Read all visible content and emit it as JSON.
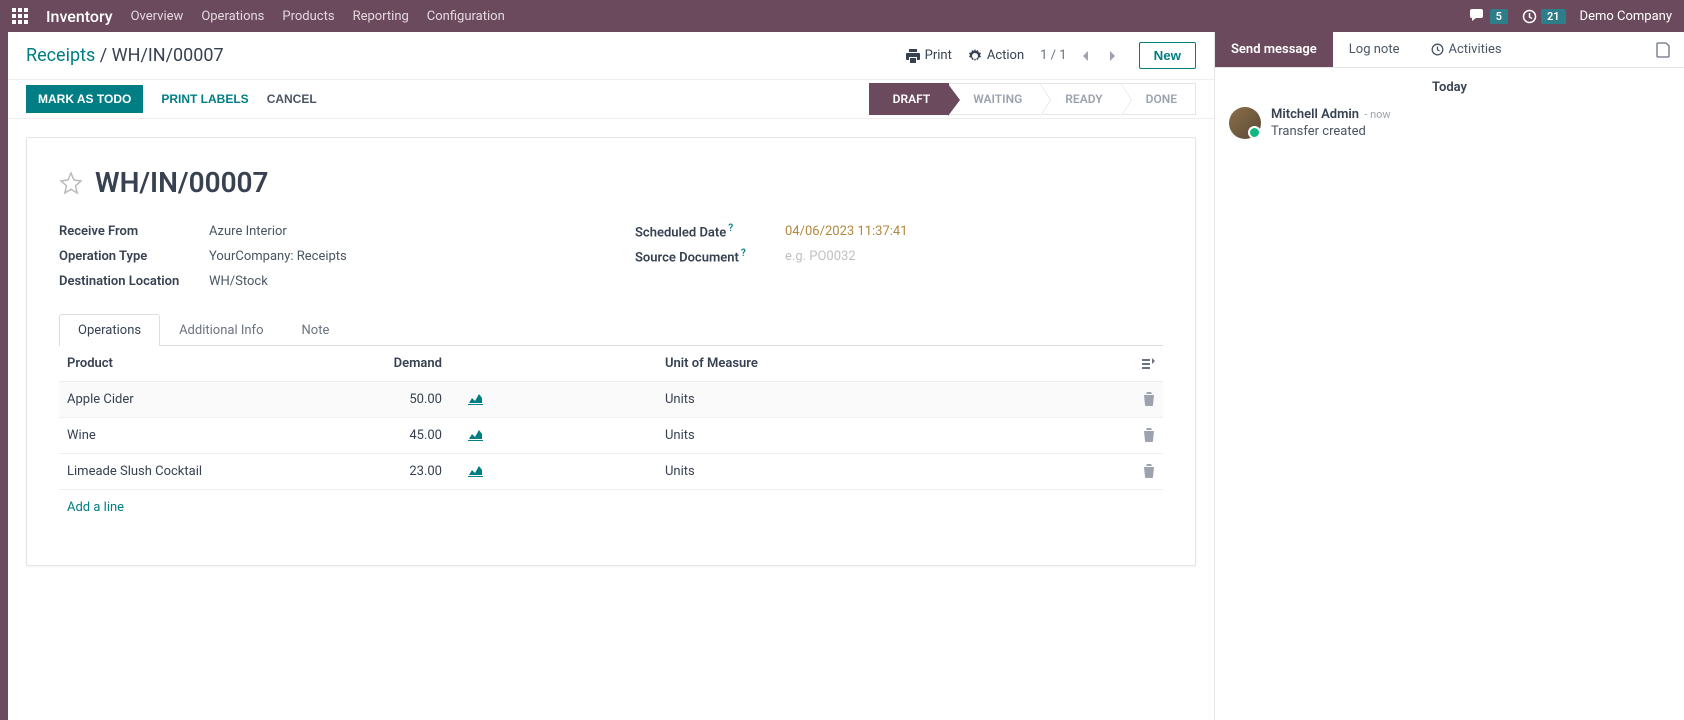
{
  "nav": {
    "app": "Inventory",
    "items": [
      "Overview",
      "Operations",
      "Products",
      "Reporting",
      "Configuration"
    ],
    "chat_badge": "5",
    "clock_badge": "21",
    "company": "Demo Company"
  },
  "breadcrumb": {
    "parent": "Receipts",
    "sep": " / ",
    "current": "WH/IN/00007"
  },
  "controlbar": {
    "print": "Print",
    "action": "Action",
    "pager": "1 / 1",
    "new": "New"
  },
  "statusbar": {
    "mark_todo": "MARK AS TODO",
    "print_labels": "PRINT LABELS",
    "cancel": "CANCEL",
    "stages": [
      "DRAFT",
      "WAITING",
      "READY",
      "DONE"
    ],
    "active_stage": 0
  },
  "record": {
    "name": "WH/IN/00007",
    "labels": {
      "receive_from": "Receive From",
      "operation_type": "Operation Type",
      "destination_location": "Destination Location",
      "scheduled_date": "Scheduled Date",
      "source_document": "Source Document"
    },
    "receive_from": "Azure Interior",
    "operation_type": "YourCompany: Receipts",
    "destination_location": "WH/Stock",
    "scheduled_date": "04/06/2023 11:37:41",
    "source_document_placeholder": "e.g. PO0032"
  },
  "tabs": [
    "Operations",
    "Additional Info",
    "Note"
  ],
  "table": {
    "headers": {
      "product": "Product",
      "demand": "Demand",
      "uom": "Unit of Measure"
    },
    "rows": [
      {
        "product": "Apple Cider",
        "demand": "50.00",
        "uom": "Units"
      },
      {
        "product": "Wine",
        "demand": "45.00",
        "uom": "Units"
      },
      {
        "product": "Limeade Slush Cocktail",
        "demand": "23.00",
        "uom": "Units"
      }
    ],
    "add_line": "Add a line"
  },
  "chatter": {
    "send_message": "Send message",
    "log_note": "Log note",
    "activities": "Activities",
    "today": "Today",
    "msg": {
      "author": "Mitchell Admin",
      "time": "- now",
      "text": "Transfer created"
    }
  }
}
